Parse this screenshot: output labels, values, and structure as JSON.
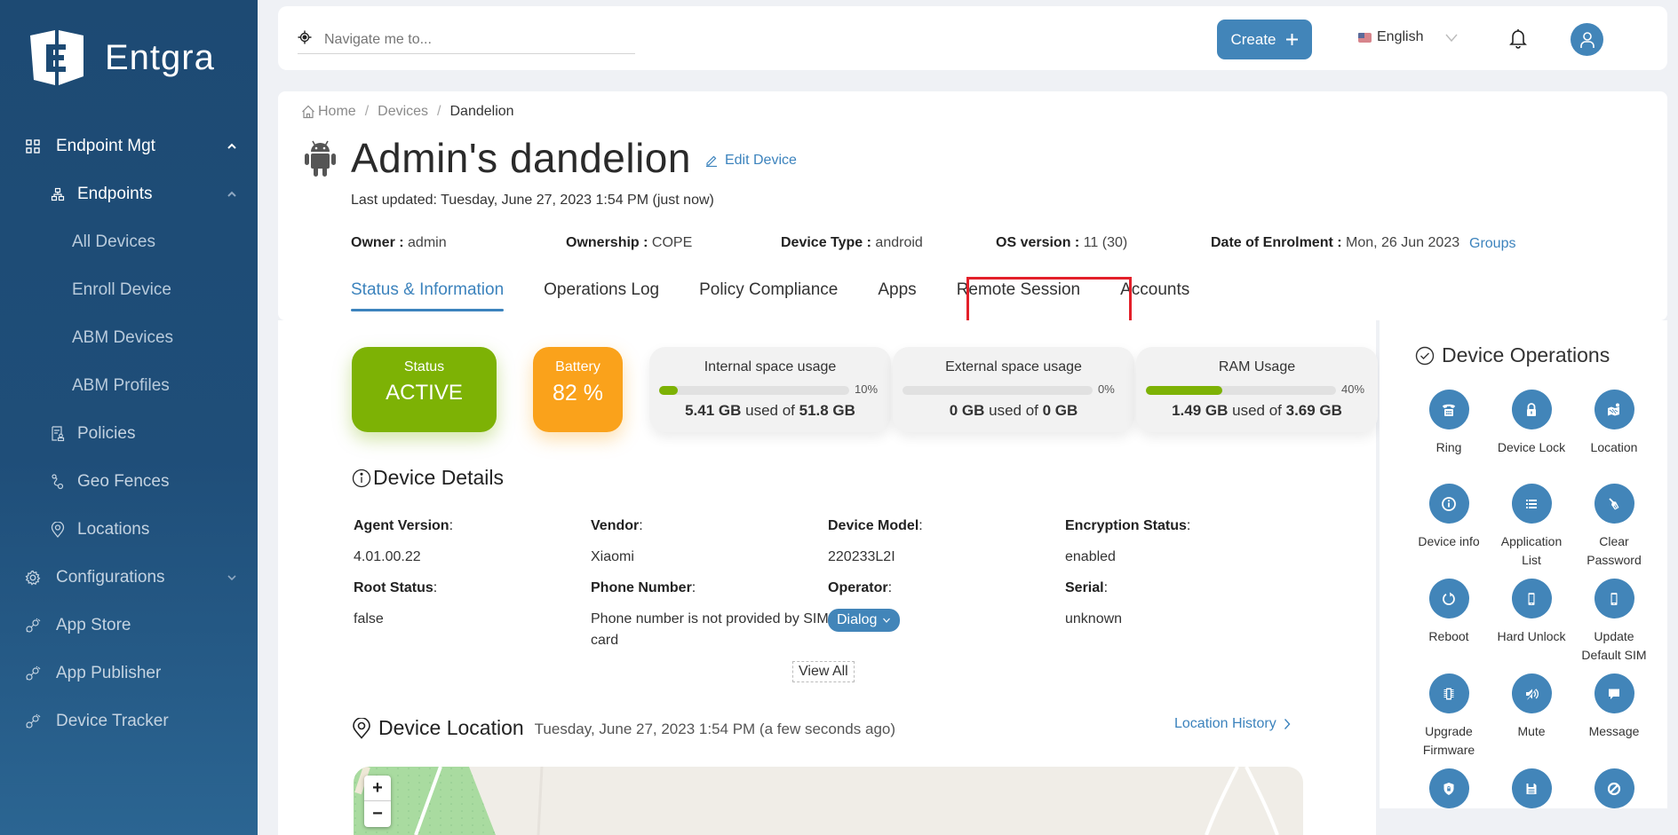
{
  "brand": {
    "name": "Entgra"
  },
  "sidebar": {
    "items": [
      {
        "label": "Endpoint Mgt",
        "icon": "grid-icon",
        "level": 0,
        "expanded": true
      },
      {
        "label": "Endpoints",
        "icon": "sitemap-icon",
        "level": 1,
        "expanded": true
      },
      {
        "label": "All Devices",
        "level": 2
      },
      {
        "label": "Enroll Device",
        "level": 2
      },
      {
        "label": "ABM Devices",
        "level": 2
      },
      {
        "label": "ABM Profiles",
        "level": 2
      },
      {
        "label": "Policies",
        "icon": "policy-icon",
        "level": 1
      },
      {
        "label": "Geo Fences",
        "icon": "geofence-icon",
        "level": 1
      },
      {
        "label": "Locations",
        "icon": "location-pin-icon",
        "level": 1
      },
      {
        "label": "Configurations",
        "icon": "gear-icon",
        "level": 0,
        "expanded": false
      },
      {
        "label": "App Store",
        "icon": "plug-icon",
        "level": 0
      },
      {
        "label": "App Publisher",
        "icon": "plug-icon",
        "level": 0
      },
      {
        "label": "Device Tracker",
        "icon": "plug-icon",
        "level": 0
      }
    ]
  },
  "topbar": {
    "search_placeholder": "Navigate me to...",
    "create_label": "Create",
    "language": "English"
  },
  "breadcrumb": {
    "home": "Home",
    "devices": "Devices",
    "current": "Dandelion"
  },
  "device": {
    "title": "Admin's dandelion",
    "edit_label": "Edit Device",
    "last_updated": "Last updated: Tuesday, June 27, 2023 1:54 PM (just now)",
    "meta": [
      {
        "key": "Owner :",
        "value": "admin"
      },
      {
        "key": "Ownership :",
        "value": "COPE"
      },
      {
        "key": "Device Type :",
        "value": "android"
      },
      {
        "key": "OS version :",
        "value": "11 (30)"
      },
      {
        "key": "Date of Enrolment :",
        "value": "Mon, 26 Jun 2023"
      }
    ],
    "groups_label": "Groups"
  },
  "tabs": [
    {
      "label": "Status & Information",
      "active": true
    },
    {
      "label": "Operations Log"
    },
    {
      "label": "Policy Compliance"
    },
    {
      "label": "Apps"
    },
    {
      "label": "Remote Session",
      "highlighted": true
    },
    {
      "label": "Accounts"
    }
  ],
  "status": {
    "status_label": "Status",
    "status_value": "ACTIVE",
    "battery_label": "Battery",
    "battery_value": "82 %",
    "colors": {
      "active": "#7db205",
      "battery": "#faa21b",
      "accent": "#4285b9",
      "highlight": "#e3202a"
    }
  },
  "usage": [
    {
      "label": "Internal space usage",
      "percent": 10,
      "percent_label": "10%",
      "used": "5.41 GB",
      "mid": "used of",
      "total": "51.8 GB"
    },
    {
      "label": "External space usage",
      "percent": 0,
      "percent_label": "0%",
      "used": "0 GB",
      "mid": "used of",
      "total": "0 GB"
    },
    {
      "label": "RAM Usage",
      "percent": 40,
      "percent_label": "40%",
      "used": "1.49 GB",
      "mid": "used of",
      "total": "3.69 GB"
    }
  ],
  "details": {
    "title": "Device Details",
    "fields": [
      {
        "key": "Agent Version",
        "value": "4.01.00.22"
      },
      {
        "key": "Vendor",
        "value": "Xiaomi"
      },
      {
        "key": "Device Model",
        "value": "220233L2I"
      },
      {
        "key": "Encryption Status",
        "value": "enabled"
      },
      {
        "key": "Root Status",
        "value": "false"
      },
      {
        "key": "Phone Number",
        "value": "Phone number is not provided by SIM card"
      },
      {
        "key": "Operator",
        "value": "Dialog"
      },
      {
        "key": "Serial",
        "value": "unknown"
      }
    ],
    "view_all": "View All"
  },
  "location": {
    "title": "Device Location",
    "timestamp": "Tuesday, June 27, 2023 1:54 PM (a few seconds ago)",
    "history_label": "Location History",
    "zoom_in": "+",
    "zoom_out": "−"
  },
  "operations": {
    "title": "Device Operations",
    "items": [
      {
        "label": "Ring",
        "icon": "phone-icon"
      },
      {
        "label": "Device Lock",
        "icon": "lock-icon"
      },
      {
        "label": "Location",
        "icon": "map-icon"
      },
      {
        "label": "Device info",
        "icon": "info-icon"
      },
      {
        "label": "Application List",
        "icon": "list-icon"
      },
      {
        "label": "Clear Password",
        "icon": "broom-icon"
      },
      {
        "label": "Reboot",
        "icon": "reboot-icon"
      },
      {
        "label": "Hard Unlock",
        "icon": "mobile-icon"
      },
      {
        "label": "Update Default SIM",
        "icon": "mobile-icon"
      },
      {
        "label": "Upgrade Firmware",
        "icon": "chip-icon"
      },
      {
        "label": "Mute",
        "icon": "mute-icon"
      },
      {
        "label": "Message",
        "icon": "message-icon"
      },
      {
        "label": "",
        "icon": "shield-lock-icon"
      },
      {
        "label": "",
        "icon": "save-icon"
      },
      {
        "label": "",
        "icon": "block-icon"
      }
    ]
  }
}
